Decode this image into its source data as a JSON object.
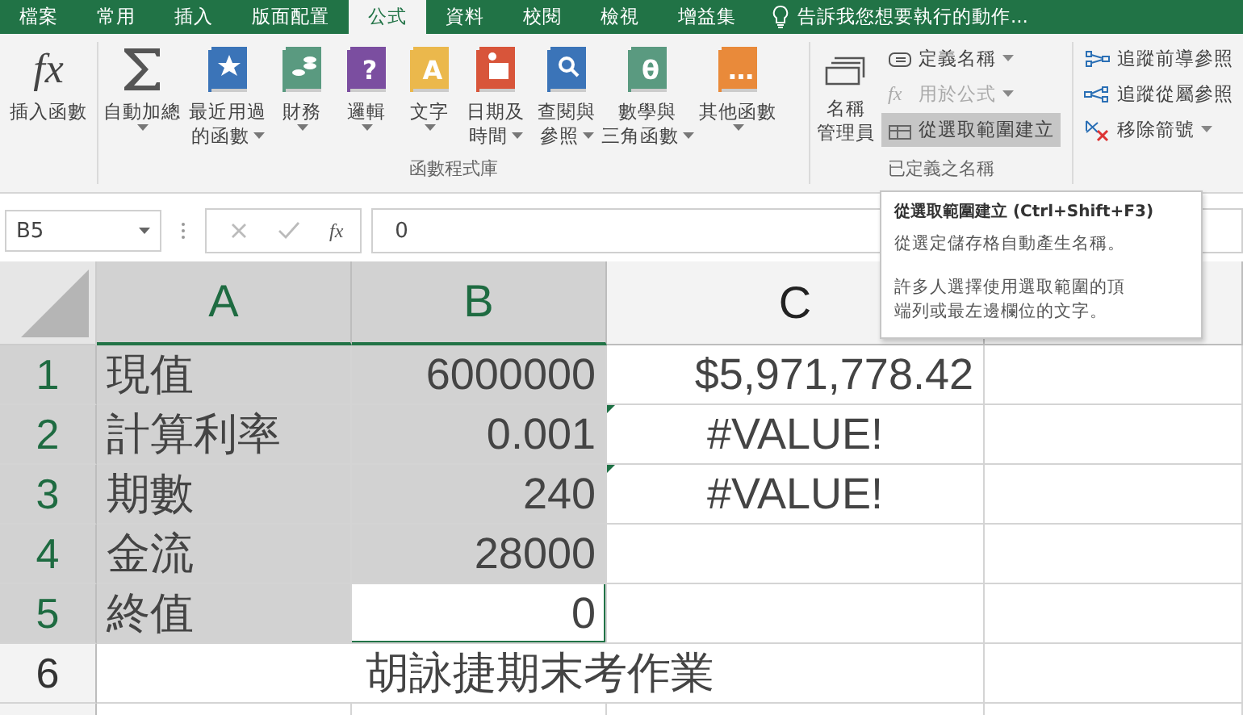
{
  "tabs": [
    {
      "label": "檔案",
      "selected": false
    },
    {
      "label": "常用",
      "selected": false
    },
    {
      "label": "插入",
      "selected": false
    },
    {
      "label": "版面配置",
      "selected": false
    },
    {
      "label": "公式",
      "selected": true
    },
    {
      "label": "資料",
      "selected": false
    },
    {
      "label": "校閱",
      "selected": false
    },
    {
      "label": "檢視",
      "selected": false
    },
    {
      "label": "增益集",
      "selected": false
    }
  ],
  "tell_me": "告訴我您想要執行的動作...",
  "ribbon": {
    "insert_function": {
      "icon_text": "fx",
      "label": "插入函數"
    },
    "library": {
      "label": "函數程式庫",
      "buttons": [
        {
          "lines": [
            "自動加總"
          ],
          "dropdown": true,
          "kind": "sum"
        },
        {
          "lines": [
            "最近用過",
            "的函數"
          ],
          "dropdown": true,
          "kind": "star",
          "color": "#3b74b8"
        },
        {
          "lines": [
            "財務"
          ],
          "dropdown": true,
          "kind": "coins",
          "color": "#5a9a80"
        },
        {
          "lines": [
            "邏輯"
          ],
          "dropdown": true,
          "kind": "glyph",
          "color": "#7b4ea0",
          "glyph": "?"
        },
        {
          "lines": [
            "文字"
          ],
          "dropdown": true,
          "kind": "glyph",
          "color": "#ebb84c",
          "glyph": "A"
        },
        {
          "lines": [
            "日期及",
            "時間"
          ],
          "dropdown": true,
          "kind": "calendar",
          "color": "#d8553a"
        },
        {
          "lines": [
            "查閱與",
            "參照"
          ],
          "dropdown": true,
          "kind": "magnifier",
          "color": "#3b74b8"
        },
        {
          "lines": [
            "數學與",
            "三角函數"
          ],
          "dropdown": true,
          "kind": "glyph",
          "color": "#5a9a80",
          "glyph": "θ"
        },
        {
          "lines": [
            "其他函數"
          ],
          "dropdown": true,
          "kind": "glyph",
          "color": "#e98a3a",
          "glyph": "…"
        }
      ]
    },
    "names": {
      "label": "已定義之名稱",
      "manager": [
        "名稱",
        "管理員"
      ],
      "items": [
        {
          "label": "定義名稱",
          "dropdown": true,
          "disabled": false,
          "selected": false,
          "kind": "tag"
        },
        {
          "label": "用於公式",
          "dropdown": true,
          "disabled": true,
          "selected": false,
          "kind": "fx",
          "icon_text": "fx"
        },
        {
          "label": "從選取範圍建立",
          "dropdown": false,
          "disabled": false,
          "selected": true,
          "kind": "grid"
        }
      ]
    },
    "auditing": {
      "items": [
        {
          "label": "追蹤前導參照",
          "dropdown": false,
          "kind": "precedents"
        },
        {
          "label": "追蹤從屬參照",
          "dropdown": false,
          "kind": "dependents"
        },
        {
          "label": "移除箭號",
          "dropdown": true,
          "kind": "remove"
        }
      ]
    }
  },
  "formula_bar": {
    "name_box": "B5",
    "function_button": "fx",
    "value": "0"
  },
  "tooltip": {
    "title": "從選取範圍建立 (Ctrl+Shift+F3)",
    "paragraphs": [
      "從選定儲存格自動產生名稱。",
      "許多人選擇使用選取範圍的頂端列或最左邊欄位的文字。"
    ]
  },
  "columns": [
    {
      "label": "A",
      "selected": true
    },
    {
      "label": "B",
      "selected": true
    },
    {
      "label": "C",
      "selected": false
    }
  ],
  "rows": [
    {
      "header": "1",
      "selected": true,
      "cells": [
        {
          "text": "現值",
          "kind": "text"
        },
        {
          "text": "6000000",
          "kind": "number"
        },
        {
          "text": "$5,971,778.42",
          "kind": "number"
        }
      ]
    },
    {
      "header": "2",
      "selected": true,
      "cells": [
        {
          "text": "計算利率",
          "kind": "text"
        },
        {
          "text": "0.001",
          "kind": "number"
        },
        {
          "text": "#VALUE!",
          "kind": "error",
          "error_flag": true
        }
      ]
    },
    {
      "header": "3",
      "selected": true,
      "cells": [
        {
          "text": "期數",
          "kind": "text"
        },
        {
          "text": "240",
          "kind": "number"
        },
        {
          "text": "#VALUE!",
          "kind": "error",
          "error_flag": true
        }
      ]
    },
    {
      "header": "4",
      "selected": true,
      "cells": [
        {
          "text": "金流",
          "kind": "text"
        },
        {
          "text": "28000",
          "kind": "number"
        },
        {
          "kind": "empty"
        }
      ]
    },
    {
      "header": "5",
      "selected": true,
      "cells": [
        {
          "text": "終值",
          "kind": "text"
        },
        {
          "text": "0",
          "kind": "number",
          "active": true
        },
        {
          "kind": "empty"
        }
      ]
    },
    {
      "header": "6",
      "selected": false,
      "cells": [
        {
          "text": "胡詠捷期末考作業",
          "kind": "title"
        }
      ]
    }
  ]
}
